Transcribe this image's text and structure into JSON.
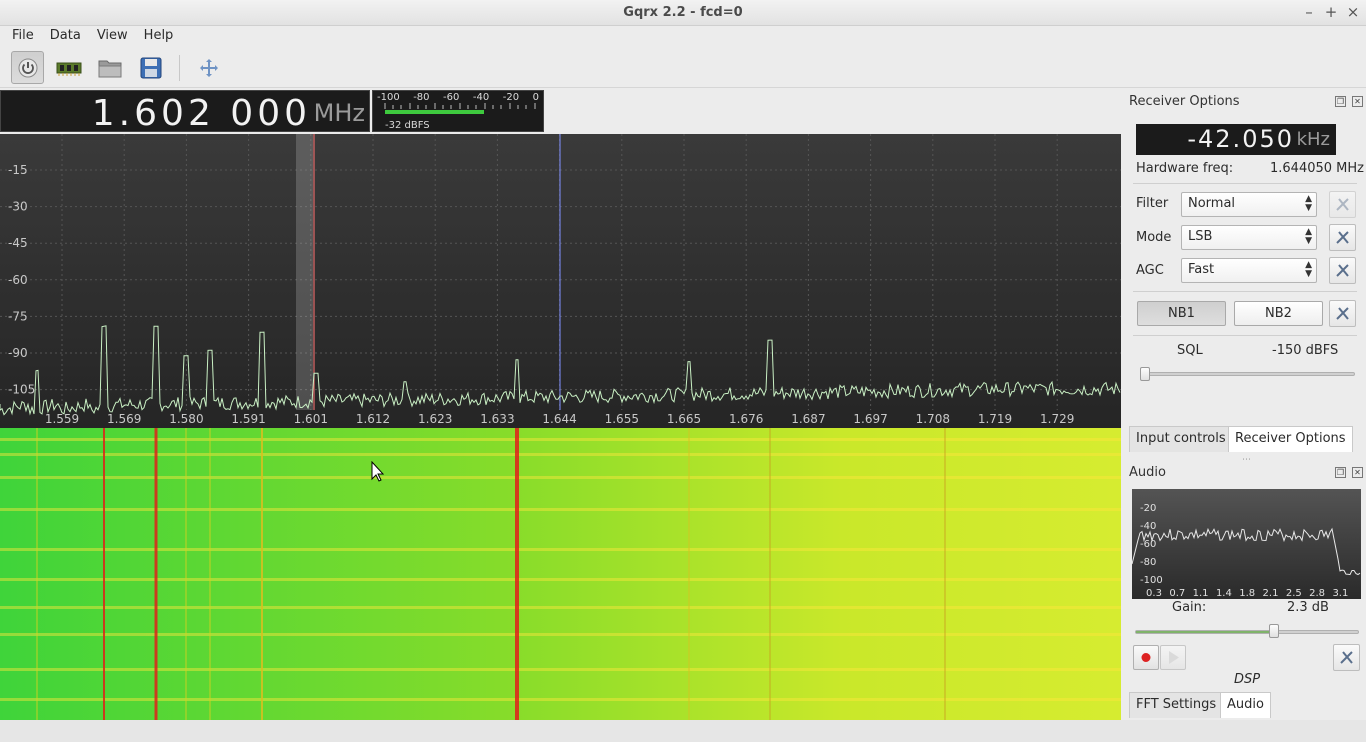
{
  "window": {
    "title": "Gqrx 2.2 - fcd=0"
  },
  "menu": [
    "File",
    "Data",
    "View",
    "Help"
  ],
  "toolbar": {
    "icons": [
      "power-icon",
      "hardware-icon",
      "open-folder-icon",
      "save-icon",
      "fullscreen-icon"
    ]
  },
  "frequency": {
    "digits": "1.602 000",
    "unit": "MHz"
  },
  "signal_meter": {
    "scale": [
      "-100",
      "-80",
      "-60",
      "-40",
      "-20",
      "0"
    ],
    "level_fraction": 0.66,
    "readout": "-32 dBFS"
  },
  "spectrum": {
    "y_labels": [
      "-15",
      "-30",
      "-45",
      "-60",
      "-75",
      "-90",
      "-105"
    ],
    "x_labels": [
      "1.559",
      "1.569",
      "1.580",
      "1.591",
      "1.601",
      "1.612",
      "1.623",
      "1.633",
      "1.644",
      "1.655",
      "1.665",
      "1.676",
      "1.687",
      "1.697",
      "1.708",
      "1.719",
      "1.729"
    ]
  },
  "receiver": {
    "title": "Receiver Options",
    "offset": "-42.050",
    "offset_unit": "kHz",
    "hw_freq_label": "Hardware freq:",
    "hw_freq_value": "1.644050 MHz",
    "filter_label": "Filter",
    "filter_value": "Normal",
    "mode_label": "Mode",
    "mode_value": "LSB",
    "agc_label": "AGC",
    "agc_value": "Fast",
    "nb1": "NB1",
    "nb2": "NB2",
    "sql_label": "SQL",
    "sql_value": "-150 dBFS"
  },
  "tabs_top": [
    "Input controls",
    "Receiver Options"
  ],
  "audio": {
    "title": "Audio",
    "y_labels": [
      "-20",
      "-40",
      "-60",
      "-80",
      "-100"
    ],
    "x_labels": [
      "0.3",
      "0.7",
      "1.1",
      "1.4",
      "1.8",
      "2.1",
      "2.5",
      "2.8",
      "3.1"
    ],
    "gain_label": "Gain:",
    "gain_value": "2.3 dB",
    "gain_fraction": 0.62,
    "dsp_label": "DSP"
  },
  "tabs_bottom": [
    "FFT Settings",
    "Audio"
  ]
}
